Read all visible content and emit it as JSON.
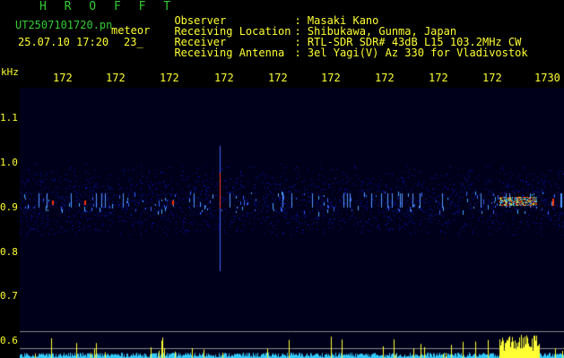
{
  "header": {
    "logo": "H R O F F T",
    "filename": "UT2507101720.pn",
    "meteor_label": "meteor",
    "datetime": "25.07.10 17:20",
    "count": "23_",
    "rows": [
      {
        "label": "Observer",
        "sep": ": ",
        "value": "Masaki Kano"
      },
      {
        "label": "Receiving Location",
        "sep": ": ",
        "value": "Shibukawa, Gunma, Japan"
      },
      {
        "label": "Receiver",
        "sep": ": ",
        "value": "RTL-SDR SDR# 43dB L15 103.2MHz CW"
      },
      {
        "label": "Receiving Antenna",
        "sep": ": ",
        "value": "3el Yagi(V) Az 330 for Vladivostok"
      }
    ]
  },
  "axes": {
    "y_unit": "kHz",
    "x_ticks": [
      "172",
      "172",
      "172",
      "172",
      "172",
      "172",
      "172",
      "172",
      "172",
      "1730"
    ],
    "y_ticks": [
      "1.1",
      "1.0",
      "0.9",
      "0.8",
      "0.7",
      "0.6"
    ]
  },
  "colors": {
    "text": "#ffff33",
    "logo": "#33cc33",
    "background": "#000000",
    "signal_blue": "#2244ff",
    "meteor_red": "#ff2200"
  }
}
